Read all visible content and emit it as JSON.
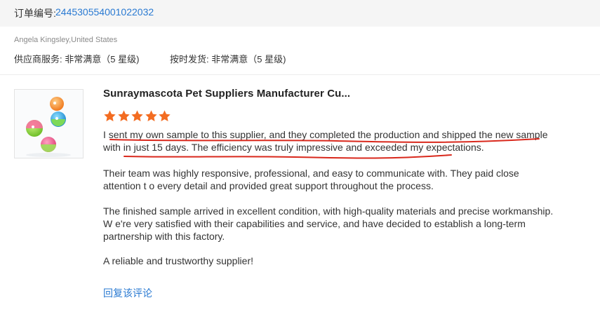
{
  "order": {
    "label": "订单编号:",
    "number": "244530554001022032"
  },
  "buyer": {
    "line": "Angela Kingsley,United States"
  },
  "ratings": [
    {
      "label": "供应商服务:",
      "value": "非常满意（5 星级)"
    },
    {
      "label": "按时发货:",
      "value": "非常满意（5 星级)"
    }
  ],
  "product": {
    "title": "Sunraymascota Pet Suppliers Manufacturer Cu..."
  },
  "stars": {
    "count": 5,
    "color": "#f36c21"
  },
  "review": {
    "paragraphs": [
      "I sent my own sample to this supplier, and they completed the production and shipped the new sample with in just 15 days. The efficiency was truly impressive and exceeded my expectations.",
      "Their team was highly responsive, professional, and easy to communicate with. They paid close attention t o every detail and provided great support throughout the process.",
      "The finished sample arrived in excellent condition, with high-quality materials and precise workmanship. W e're very satisfied with their capabilities and service, and have decided to establish a long-term partnership with this factory.",
      "A reliable and trustworthy supplier!"
    ]
  },
  "actions": {
    "reply": "回复该评论"
  },
  "colors": {
    "link": "#2a7ad2",
    "annotation": "#d9281c",
    "header_bg": "#f5f5f5"
  }
}
